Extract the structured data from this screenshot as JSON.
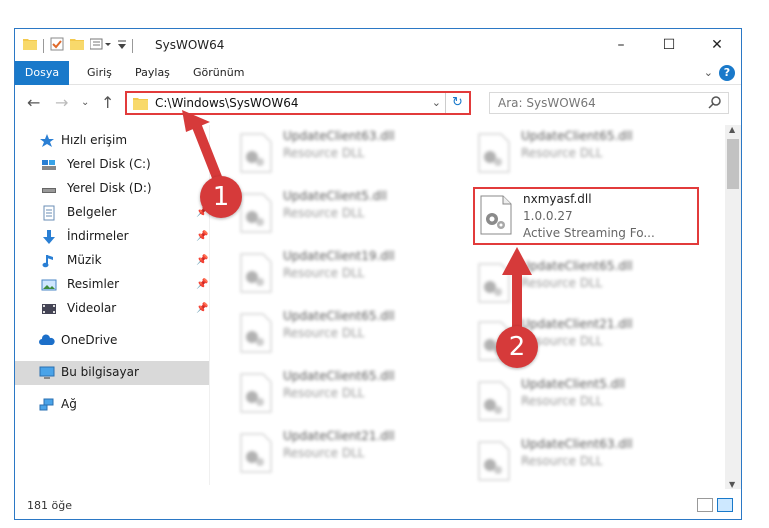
{
  "window": {
    "title": "SysWOW64",
    "controls": {
      "minimize": "–",
      "maximize": "☐",
      "close": "✕"
    }
  },
  "ribbon": {
    "tabs": [
      "Dosya",
      "Giriş",
      "Paylaş",
      "Görünüm"
    ],
    "help": "?"
  },
  "address": {
    "path": "C:\\Windows\\SysWOW64",
    "search_placeholder": "Ara: SysWOW64"
  },
  "sidebar": {
    "quick_access": "Hızlı erişim",
    "items": [
      {
        "label": "Yerel Disk (C:)",
        "icon": "drive-icon",
        "pinned": false
      },
      {
        "label": "Yerel Disk (D:)",
        "icon": "drive-icon",
        "pinned": false
      },
      {
        "label": "Belgeler",
        "icon": "documents-icon",
        "pinned": true
      },
      {
        "label": "İndirmeler",
        "icon": "downloads-icon",
        "pinned": true
      },
      {
        "label": "Müzik",
        "icon": "music-icon",
        "pinned": true
      },
      {
        "label": "Resimler",
        "icon": "pictures-icon",
        "pinned": true
      },
      {
        "label": "Videolar",
        "icon": "videos-icon",
        "pinned": true
      }
    ],
    "onedrive": "OneDrive",
    "this_pc": "Bu bilgisayar",
    "network": "Ağ"
  },
  "files": {
    "left_column": [
      {
        "name": "UpdateClient63.dll",
        "desc": "Resource DLL"
      },
      {
        "name": "UpdateClient5.dll",
        "desc": "Resource DLL"
      },
      {
        "name": "UpdateClient19.dll",
        "desc": "Resource DLL"
      },
      {
        "name": "UpdateClient65.dll",
        "desc": "Resource DLL"
      },
      {
        "name": "UpdateClient65.dll",
        "desc": "Resource DLL"
      },
      {
        "name": "UpdateClient21.dll",
        "desc": "Resource DLL"
      }
    ],
    "right_column": [
      {
        "name": "UpdateClient65.dll",
        "desc": "Resource DLL"
      },
      {
        "name": "UpdateClient65.dll",
        "desc": "Resource DLL"
      },
      {
        "name": "UpdateClient21.dll",
        "desc": "Resource DLL"
      },
      {
        "name": "UpdateClient5.dll",
        "desc": "Resource DLL"
      },
      {
        "name": "UpdateClient63.dll",
        "desc": "Resource DLL"
      }
    ],
    "selected": {
      "name": "nxmyasf.dll",
      "version": "1.0.0.27",
      "desc": "Active Streaming Fo..."
    }
  },
  "status": {
    "count": "181 öğe"
  },
  "annotations": {
    "step1": "1",
    "step2": "2"
  },
  "colors": {
    "accent": "#1979ca",
    "highlight": "#e23b3b",
    "badge": "#d63a3a"
  }
}
